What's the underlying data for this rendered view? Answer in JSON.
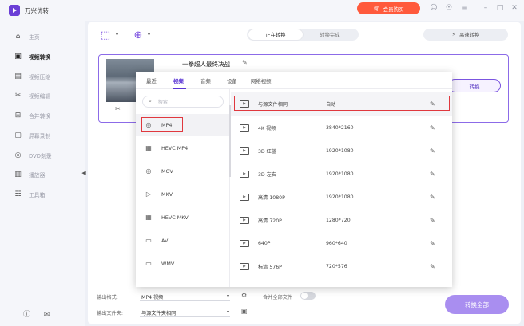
{
  "app": {
    "title": "万兴优转",
    "buy_label": "会员购买"
  },
  "sidebar": {
    "items": [
      {
        "label": "主页",
        "icon": "home-icon"
      },
      {
        "label": "视频转换",
        "icon": "video-convert-icon",
        "active": true
      },
      {
        "label": "视频压缩",
        "icon": "compress-icon"
      },
      {
        "label": "视频编辑",
        "icon": "scissors-icon"
      },
      {
        "label": "合并转换",
        "icon": "merge-icon"
      },
      {
        "label": "屏幕录制",
        "icon": "record-icon"
      },
      {
        "label": "DVD刻录",
        "icon": "disc-icon"
      },
      {
        "label": "播放器",
        "icon": "player-icon"
      },
      {
        "label": "工具箱",
        "icon": "toolbox-icon"
      }
    ]
  },
  "toolbar": {
    "tab_converting": "正在转换",
    "tab_done": "转换完成",
    "fast_label": "高速转换"
  },
  "file": {
    "title": "一拳超人最终决战",
    "convert_label": "转换"
  },
  "popup": {
    "tabs": [
      "最近",
      "视频",
      "音频",
      "设备",
      "网络视频"
    ],
    "active_tab": 1,
    "search_placeholder": "搜索",
    "formats": [
      {
        "label": "MP4",
        "icon": "mp4-icon",
        "selected": true
      },
      {
        "label": "HEVC MP4",
        "icon": "hevc-icon"
      },
      {
        "label": "MOV",
        "icon": "mov-icon"
      },
      {
        "label": "MKV",
        "icon": "mkv-icon"
      },
      {
        "label": "HEVC MKV",
        "icon": "hevc-icon"
      },
      {
        "label": "AVI",
        "icon": "avi-icon"
      },
      {
        "label": "WMV",
        "icon": "wmv-icon"
      }
    ],
    "presets": [
      {
        "name": "与源文件相同",
        "res": "自动",
        "selected": true
      },
      {
        "name": "4K 视频",
        "res": "3840*2160"
      },
      {
        "name": "3D 红蓝",
        "res": "1920*1080"
      },
      {
        "name": "3D 左右",
        "res": "1920*1080"
      },
      {
        "name": "高清 1080P",
        "res": "1920*1080"
      },
      {
        "name": "高清 720P",
        "res": "1280*720"
      },
      {
        "name": "640P",
        "res": "960*640"
      },
      {
        "name": "标清 576P",
        "res": "720*576"
      }
    ]
  },
  "bottom": {
    "output_format_label": "输出格式:",
    "output_format_value": "MP4 视频",
    "output_folder_label": "输出文件夹:",
    "output_folder_value": "与源文件夹相同",
    "merge_label": "合并全部文件",
    "convert_all_label": "转换全部"
  },
  "colors": {
    "accent": "#7b55e0",
    "buy": "#ff5a3c",
    "highlight": "#e0383e"
  }
}
